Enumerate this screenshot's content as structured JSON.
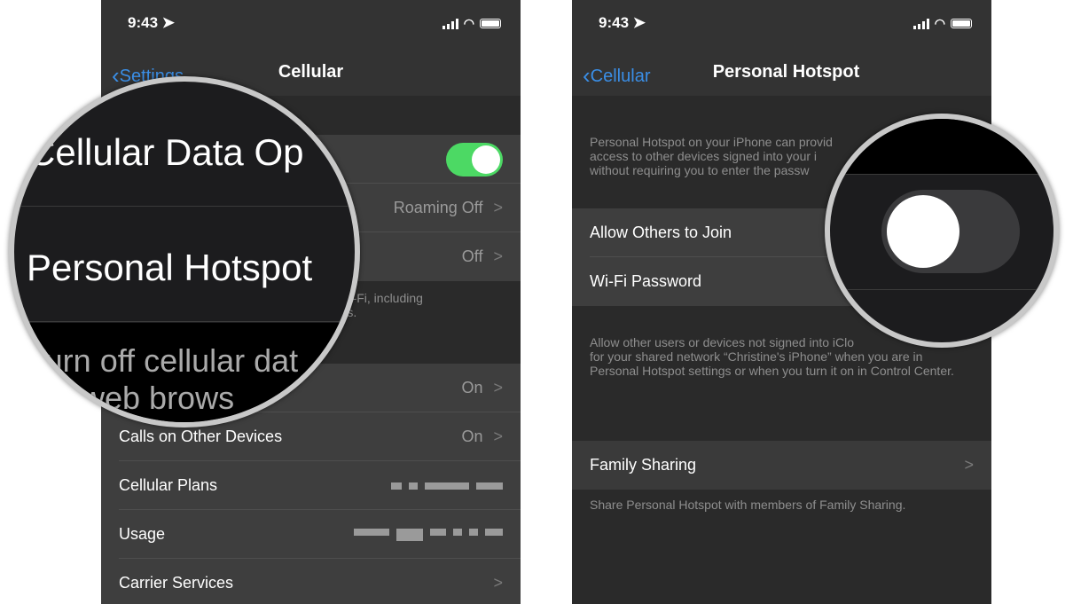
{
  "left": {
    "status": {
      "time": "9:43"
    },
    "nav": {
      "back": "Settings",
      "title": "Cellular"
    },
    "rows": [
      {
        "label": "",
        "value": "",
        "toggle": true
      },
      {
        "label": "",
        "value": "Roaming Off"
      },
      {
        "label": "",
        "value": "Off"
      }
    ],
    "footer_partial": "a to Wi-Fi, including\ncations.",
    "rows2": [
      {
        "label": "",
        "value": "On"
      },
      {
        "label": "Calls on Other Devices",
        "value": "On"
      },
      {
        "label": "Cellular Plans",
        "value": ""
      },
      {
        "label": "Usage",
        "value": ""
      },
      {
        "label": "Carrier Services",
        "value": ""
      }
    ],
    "magnifier": {
      "line1": "Cellular Data Op",
      "line2": "Personal Hotspot",
      "line3": "Turn off cellular dat",
      "line4": "il, web brows"
    }
  },
  "right": {
    "status": {
      "time": "9:43"
    },
    "nav": {
      "back": "Cellular",
      "title": "Personal Hotspot"
    },
    "header_text": "Personal Hotspot on your iPhone can provid\naccess to other devices signed into your i\nwithout requiring you to enter the passw",
    "rows": [
      {
        "label": "Allow Others to Join"
      },
      {
        "label": "Wi-Fi Password"
      }
    ],
    "footer_text": "Allow other users or devices not signed into iClo\nfor your shared network “Christine's iPhone” when you are in Personal Hotspot settings or when you turn it on in Control Center.",
    "family": {
      "label": "Family Sharing",
      "footer": "Share Personal Hotspot with members of Family Sharing."
    },
    "magnifier": {
      "toggle_on": false
    }
  },
  "colors": {
    "accent": "#3a8ee6",
    "toggle_on": "#4cd964"
  }
}
